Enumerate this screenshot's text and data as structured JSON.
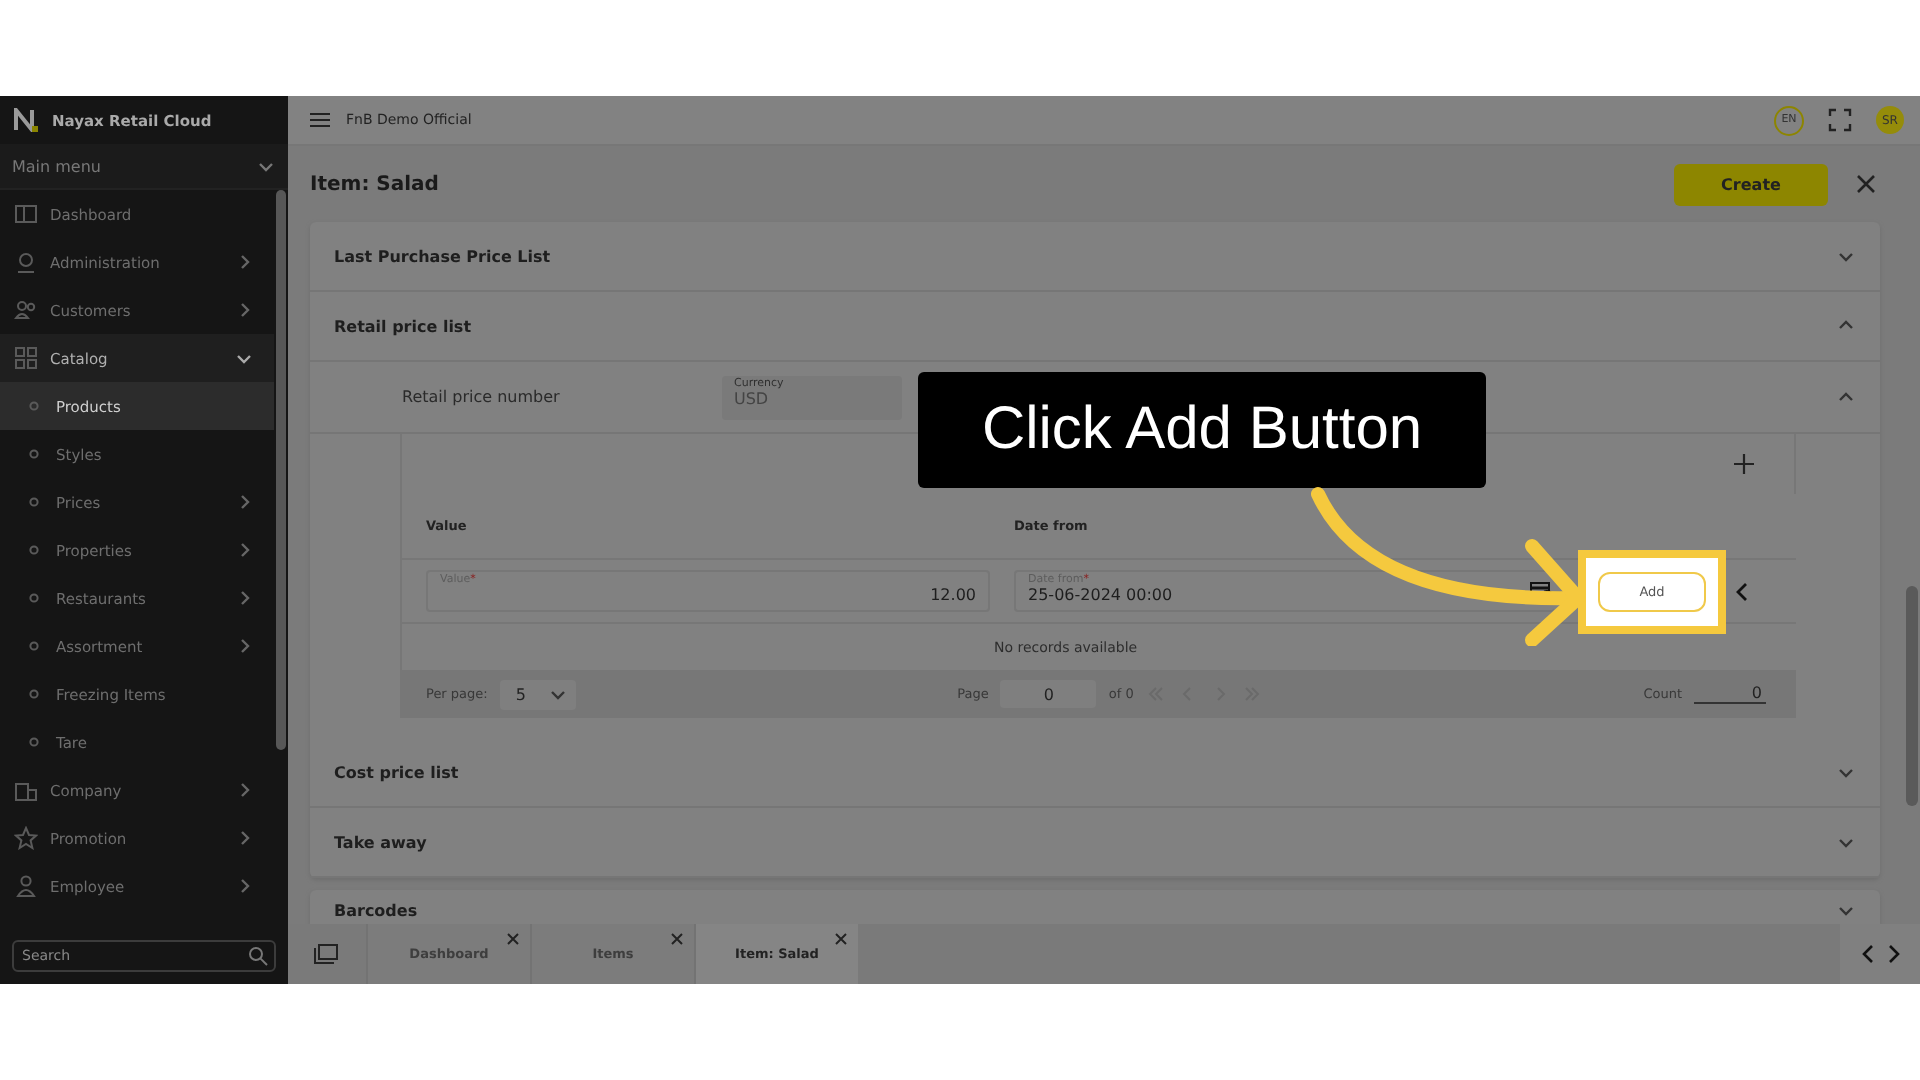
{
  "sidebar": {
    "brand": "Nayax Retail Cloud",
    "menu_title": "Main menu",
    "items": [
      {
        "label": "Dashboard",
        "selected": false
      },
      {
        "label": "Administration",
        "selected": false,
        "expanded": false
      },
      {
        "label": "Customers",
        "selected": false,
        "expanded": false
      },
      {
        "label": "Catalog",
        "selected": false,
        "expanded": true,
        "children": [
          {
            "label": "Products",
            "selected": true
          },
          {
            "label": "Styles",
            "selected": false
          },
          {
            "label": "Prices",
            "selected": false,
            "expanded": false
          },
          {
            "label": "Properties",
            "selected": false,
            "expanded": false
          },
          {
            "label": "Restaurants",
            "selected": false,
            "expanded": false
          },
          {
            "label": "Assortment",
            "selected": false,
            "expanded": false
          },
          {
            "label": "Freezing Items",
            "selected": false
          },
          {
            "label": "Tare",
            "selected": false
          }
        ]
      },
      {
        "label": "Company",
        "selected": false,
        "expanded": false
      },
      {
        "label": "Promotion",
        "selected": false,
        "expanded": false
      },
      {
        "label": "Employee",
        "selected": false,
        "expanded": false
      }
    ],
    "search_placeholder": "Search"
  },
  "top_bar": {
    "company": "FnB Demo Official",
    "language": "EN",
    "user_initials": "SR"
  },
  "page": {
    "title": "Item: Salad",
    "create_button": "Create"
  },
  "sections": [
    {
      "title": "Last Purchase Price List",
      "expanded": false
    },
    {
      "title": "Retail price list",
      "expanded": true
    },
    {
      "title": "Cost price list",
      "expanded": false
    },
    {
      "title": "Take away",
      "expanded": false
    }
  ],
  "retail": {
    "label": "Retail price number",
    "currency_label": "Currency",
    "currency_value": "USD",
    "expanded": true,
    "columns": [
      "Value",
      "Date from"
    ],
    "edit_row": {
      "value_label": "Value",
      "value_required": "*",
      "value": "12.00",
      "date_label": "Date from",
      "date_required": "*",
      "date": "25-06-2024 00:00",
      "add_button": "Add"
    },
    "empty_text": "No records available",
    "pager": {
      "per_page_label": "Per page:",
      "per_page": "5",
      "page_label": "Page",
      "page": "0",
      "of_text": "of 0",
      "count_label": "Count",
      "count": "0"
    }
  },
  "second_card": {
    "title": "Barcodes",
    "expanded": false
  },
  "tabs": [
    {
      "label": "Dashboard",
      "selected": false
    },
    {
      "label": "Items",
      "selected": false
    },
    {
      "label": "Item: Salad",
      "selected": true
    }
  ],
  "callout": {
    "text": "Click Add Button"
  }
}
